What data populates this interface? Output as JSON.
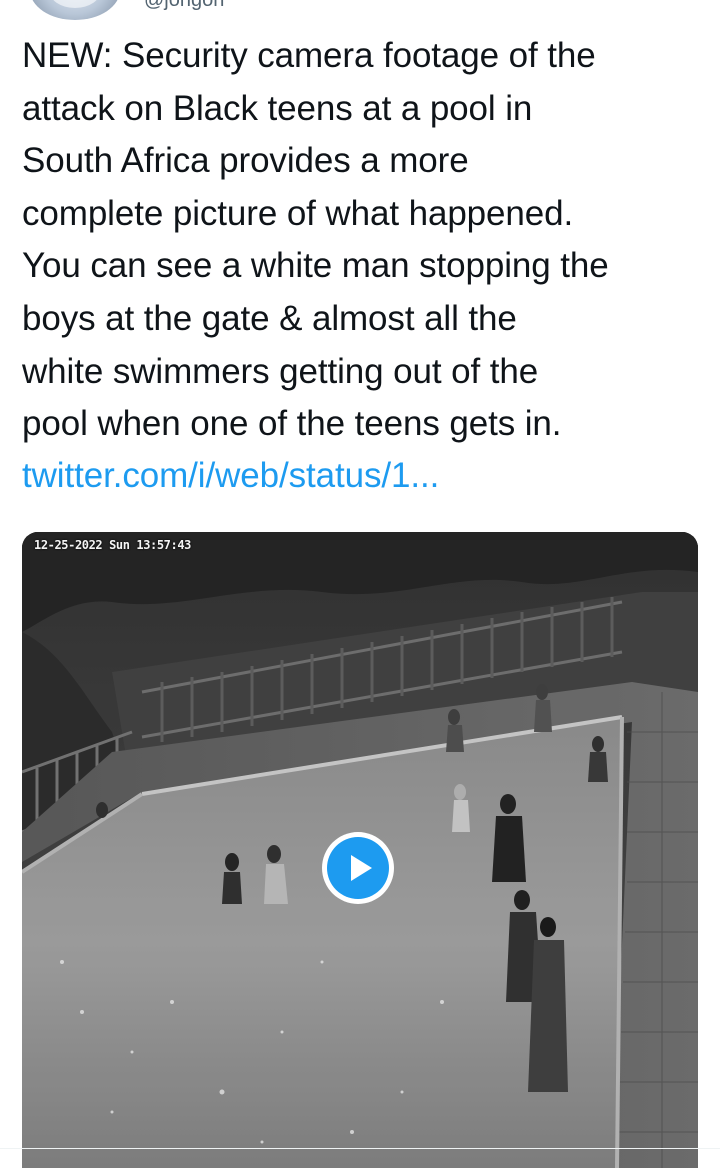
{
  "tweet": {
    "handle": "@jongon",
    "text": "NEW: Security camera footage of the\nattack on Black teens at a pool in\nSouth Africa provides a more\ncomplete picture of what happened.\nYou can see a white man stopping the\nboys at the gate & almost all the\nwhite swimmers getting out of the\npool when one of the teens gets in.",
    "link": "twitter.com/i/web/status/1..."
  },
  "media": {
    "type": "video",
    "cctv_timestamp": "12-25-2022 Sun 13:57:43",
    "play_icon": "play-icon",
    "accent_color": "#1d9bf0"
  },
  "colors": {
    "text": "#0f1419",
    "link": "#1d9bf0",
    "secondary": "#536471"
  }
}
